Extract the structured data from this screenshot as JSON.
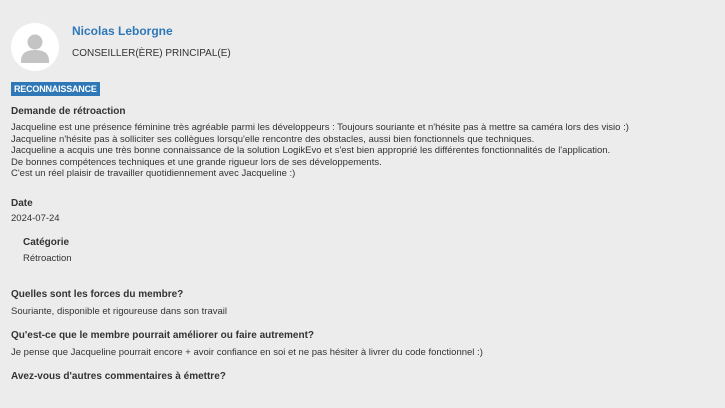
{
  "member": {
    "name": "Nicolas Leborgne",
    "role": "CONSEILLER(ÈRE) PRINCIPAL(E)",
    "avatar_icon": "user-silhouette-icon"
  },
  "badge": "RECONNAISSANCE",
  "feedback": {
    "label": "Demande de rétroaction",
    "lines": [
      "Jacqueline est une présence féminine très agréable parmi les développeurs : Toujours souriante et n'hésite pas à mettre sa caméra lors des visio :)",
      "Jacqueline n'hésite pas à solliciter ses collègues lorsqu'elle rencontre des obstacles, aussi bien fonctionnels que techniques.",
      "Jacqueline a acquis une très bonne connaissance de la solution LogikEvo et s'est bien approprié les différentes fonctionnalités de l'application.",
      "De bonnes compétences techniques et une grande rigueur lors de ses développements.",
      "C'est un réel plaisir de travailler quotidiennement avec Jacqueline :)"
    ]
  },
  "date": {
    "label": "Date",
    "value": "2024-07-24"
  },
  "category": {
    "label": "Catégorie",
    "value": "Rétroaction"
  },
  "questions": [
    {
      "question": "Quelles sont les forces du membre?",
      "answer": "Souriante, disponible et rigoureuse dans son travail"
    },
    {
      "question": "Qu'est-ce que le membre pourrait améliorer ou faire autrement?",
      "answer": "Je pense que Jacqueline pourrait encore + avoir confiance en soi et ne pas hésiter à livrer du code fonctionnel :)"
    },
    {
      "question": "Avez-vous d'autres commentaires à émettre?",
      "answer": ""
    }
  ],
  "colors": {
    "background": "#ececec",
    "accent": "#2f78b8",
    "text": "#333333"
  }
}
